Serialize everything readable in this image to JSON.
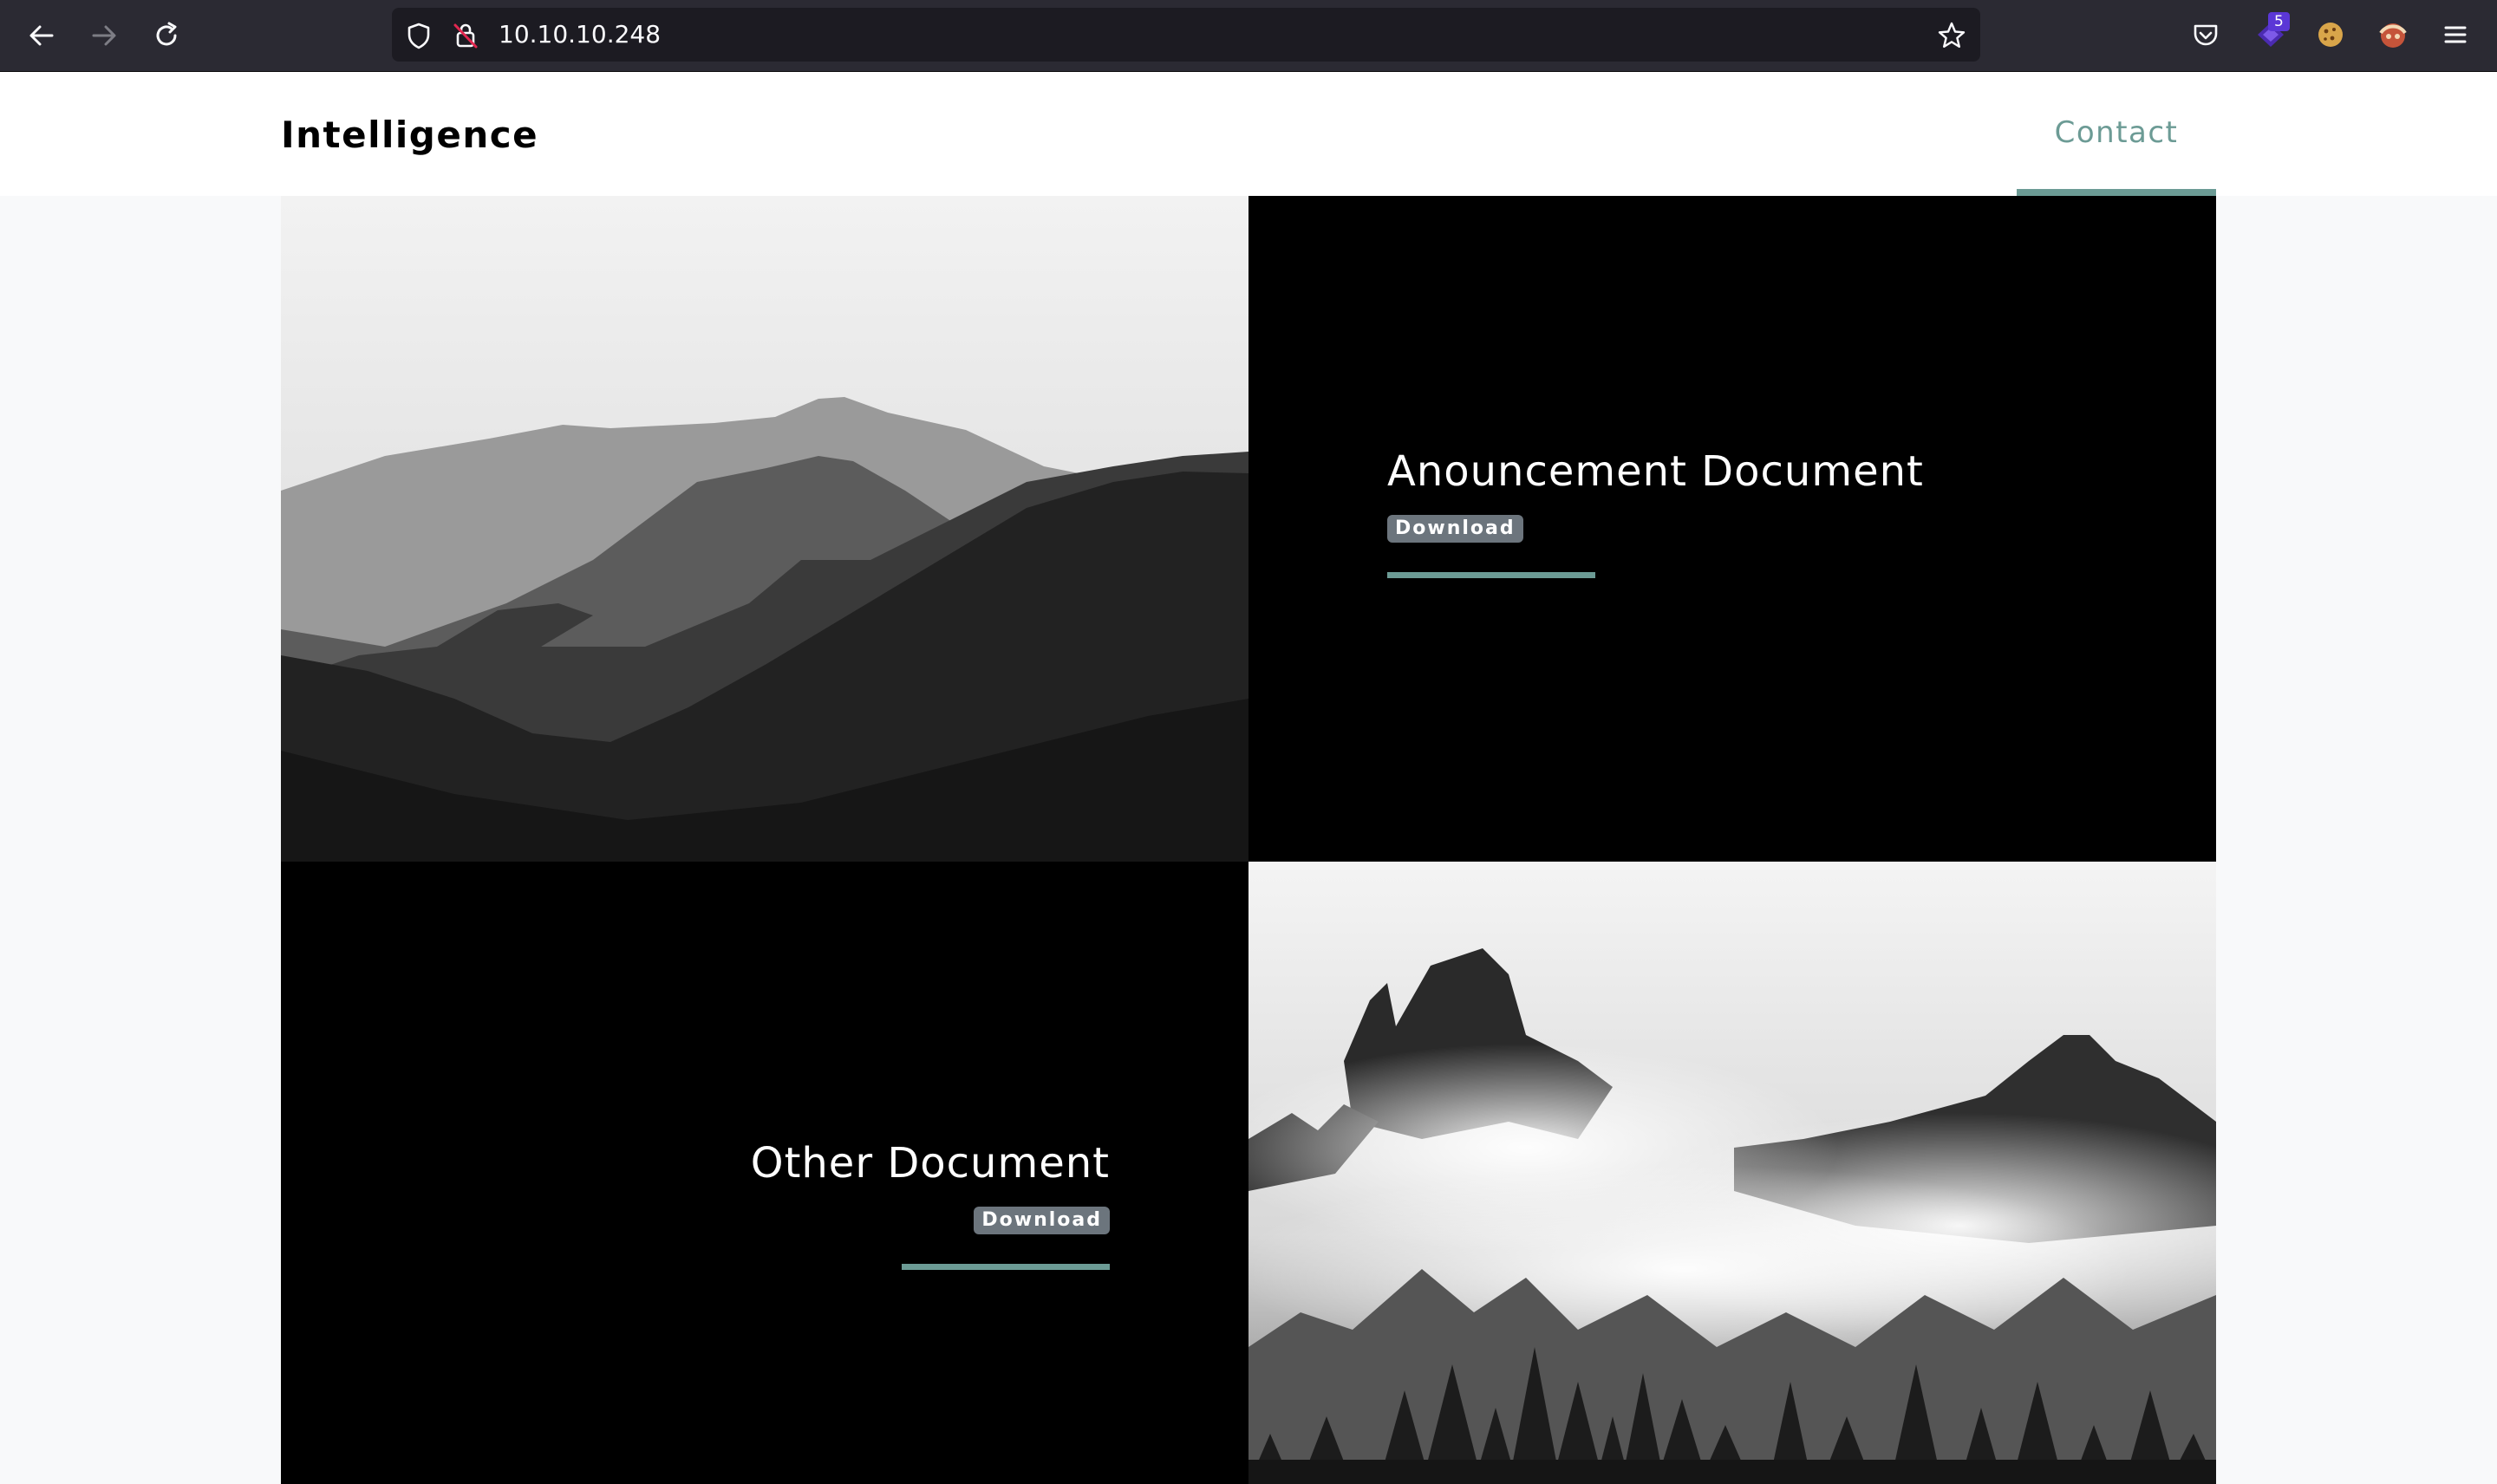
{
  "browser": {
    "url": "10.10.10.248",
    "extension_badge_count": "5",
    "icons": [
      "back-icon",
      "forward-icon",
      "reload-icon",
      "shield-icon",
      "insecure-lock-icon",
      "star-icon",
      "pocket-icon",
      "extension-icon",
      "cookie-icon",
      "extension-icon",
      "menu-icon"
    ]
  },
  "site": {
    "brand": "Intelligence",
    "nav": {
      "contact": "Contact"
    }
  },
  "documents": [
    {
      "title": "Anouncement Document",
      "action": "Download"
    },
    {
      "title": "Other Document",
      "action": "Download"
    }
  ],
  "colors": {
    "accent": "#6c9b95",
    "badge": "#6c757d",
    "chrome": "#2b2a33"
  }
}
